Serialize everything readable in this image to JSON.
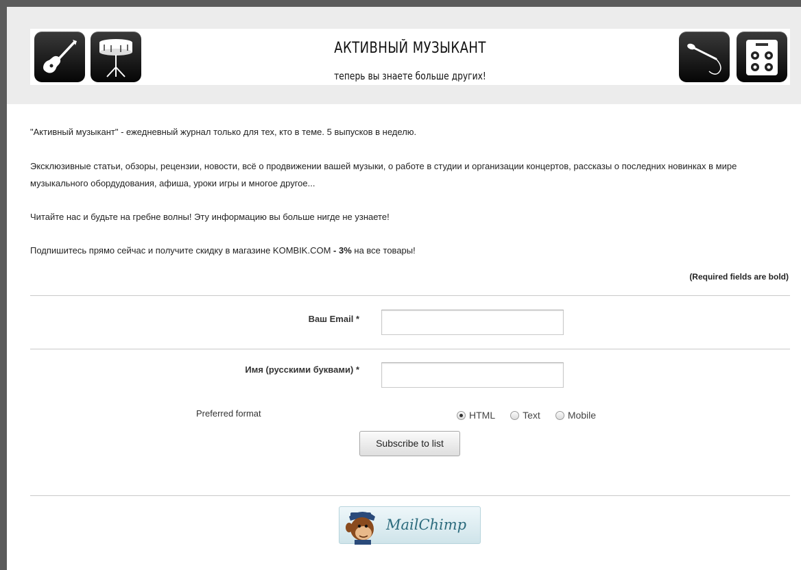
{
  "header": {
    "title": "АКТИВНЫЙ МУЗЫКАНТ",
    "subtitle": "теперь вы знаете больше других!",
    "icons": [
      "guitar-icon",
      "drum-icon",
      "microphone-icon",
      "amplifier-icon"
    ]
  },
  "intro": {
    "p1": "\"Активный музыкант\" - ежедневный журнал только для тех, кто в теме. 5 выпусков в неделю.",
    "p2": "Эксклюзивные статьи, обзоры, рецензии, новости, всё о продвижении вашей музыки, о работе в студии и организации концертов, рассказы о последних новинках в мире музыкального обордудования, афиша, уроки игры и многое другое...",
    "p3": "Читайте нас и будьте на гребне волны! Эту информацию вы больше нигде не узнаете!",
    "p4_start": "Подпишитесь прямо сейчас и получите скидку в магазине KOMBIK.COM ",
    "p4_bold": "- 3%",
    "p4_end": " на все товары!"
  },
  "form": {
    "required_note": "(Required fields are bold)",
    "email_label": "Ваш Email",
    "email_value": "",
    "name_label": "Имя (русскими буквами)",
    "name_value": "",
    "required_marker": "*",
    "format_label": "Preferred format",
    "format_options": [
      "HTML",
      "Text",
      "Mobile"
    ],
    "format_selected": "HTML",
    "submit_label": "Subscribe to list"
  },
  "footer": {
    "badge_text": "MailChimp"
  }
}
